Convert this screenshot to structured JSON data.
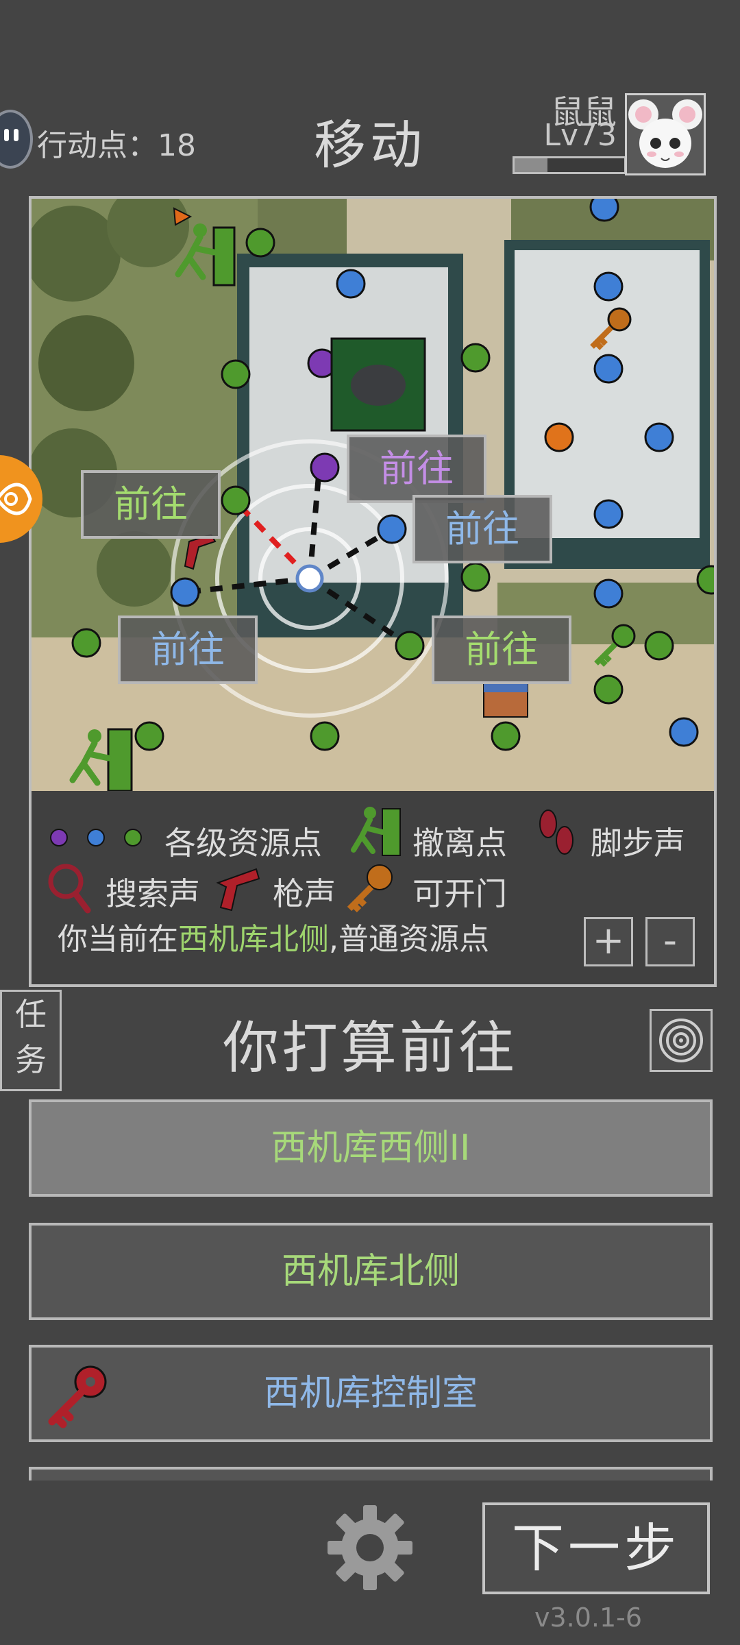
{
  "header": {
    "action_points_label": "行动点：18",
    "title": "移动",
    "player_name": "鼠鼠",
    "player_level": "Lv73",
    "xp_progress": 0.3
  },
  "map": {
    "go_buttons": [
      "前往",
      "前往",
      "前往",
      "前往",
      "前往"
    ],
    "legend": {
      "resource_points": "各级资源点",
      "extraction": "撤离点",
      "footsteps": "脚步声",
      "search_sound": "搜索声",
      "gunshot": "枪声",
      "openable_door": "可开门"
    },
    "location": {
      "prefix": "你当前在",
      "name": "西机库北侧",
      "suffix": ",普通资源点"
    },
    "zoom_in": "+",
    "zoom_out": "-"
  },
  "task_tab": "任\n务",
  "prompt": "你打算前往",
  "destinations": [
    {
      "label": "西机库西侧II"
    },
    {
      "label": "西机库北侧"
    },
    {
      "label": "西机库控制室"
    }
  ],
  "footer": {
    "next": "下一步",
    "version": "v3.0.1-6"
  },
  "colors": {
    "resource_purple": "#7d3ab3",
    "resource_blue": "#3f7fd6",
    "resource_green": "#4f9a2d",
    "accent_orange": "#f0931e",
    "location_green": "#9ed46d"
  }
}
